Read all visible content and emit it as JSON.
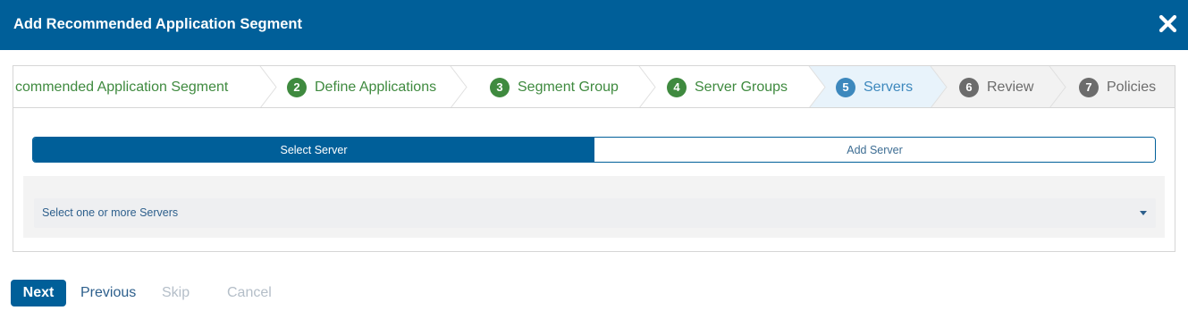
{
  "dialog": {
    "title": "Add Recommended Application Segment"
  },
  "steps": [
    {
      "number": "",
      "label": "commended Application Segment",
      "state": "done"
    },
    {
      "number": "2",
      "label": "Define Applications",
      "state": "done"
    },
    {
      "number": "3",
      "label": "Segment Group",
      "state": "done"
    },
    {
      "number": "4",
      "label": "Server Groups",
      "state": "done"
    },
    {
      "number": "5",
      "label": "Servers",
      "state": "current"
    },
    {
      "number": "6",
      "label": "Review",
      "state": "future"
    },
    {
      "number": "7",
      "label": "Policies",
      "state": "future"
    }
  ],
  "toggle": {
    "select_label": "Select Server",
    "add_label": "Add Server",
    "active": "Select Server"
  },
  "server_select": {
    "placeholder": "Select one or more Servers"
  },
  "footer": {
    "next_label": "Next",
    "previous_label": "Previous",
    "skip_label": "Skip",
    "cancel_label": "Cancel"
  },
  "colors": {
    "header": "#005f99",
    "done_step": "#3f8a3f",
    "current_step": "#3d88bd",
    "future_step": "#6c6c6c",
    "current_step_bg": "#e8f3fb",
    "disabled_text": "#b4bec8"
  },
  "icons": {
    "close": "close-icon",
    "dropdown": "caret-down-icon"
  }
}
